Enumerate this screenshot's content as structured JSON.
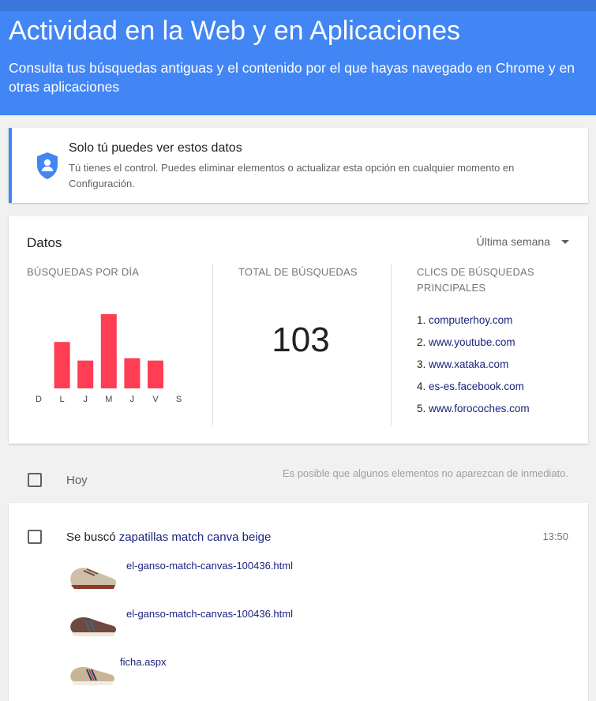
{
  "header": {
    "title": "Actividad en la Web y en Aplicaciones",
    "subtitle": "Consulta tus búsquedas antiguas y el contenido por el que hayas navegado en Chrome y en otras aplicaciones"
  },
  "privacy": {
    "title": "Solo tú puedes ver estos datos",
    "text": "Tú tienes el control. Puedes eliminar elementos o actualizar esta opción en cualquier momento en Configuración."
  },
  "datos": {
    "title": "Datos",
    "range": "Última semana",
    "searches_per_day_label": "BÚSQUEDAS POR DÍA",
    "total_label": "TOTAL DE BÚSQUEDAS",
    "total_value": "103",
    "top_clicks_label_line1": "CLICS DE BÚSQUEDAS",
    "top_clicks_label_line2": "PRINCIPALES",
    "top_sites": [
      {
        "num": "1.",
        "site": "computerhoy.com"
      },
      {
        "num": "2.",
        "site": "www.youtube.com"
      },
      {
        "num": "3.",
        "site": "www.xataka.com"
      },
      {
        "num": "4.",
        "site": "es-es.facebook.com"
      },
      {
        "num": "5.",
        "site": "www.forocoches.com"
      }
    ]
  },
  "chart_data": {
    "type": "bar",
    "categories": [
      "D",
      "L",
      "J",
      "M",
      "J",
      "V",
      "S"
    ],
    "values": [
      0,
      20,
      12,
      32,
      13,
      12,
      0
    ],
    "ylim": [
      0,
      34
    ],
    "bar_color": "#ff3d54",
    "grid": false
  },
  "list": {
    "day_label": "Hoy",
    "note": "Es posible que algunos elementos no aparezcan de inmediato.",
    "entry": {
      "prefix": "Se buscó",
      "query": "zapatillas match canva beige",
      "time": "13:50",
      "results": [
        {
          "link": "el-ganso-match-canvas-100436.html"
        },
        {
          "link": "el-ganso-match-canvas-100436.html"
        },
        {
          "link": "ficha.aspx"
        }
      ]
    }
  }
}
